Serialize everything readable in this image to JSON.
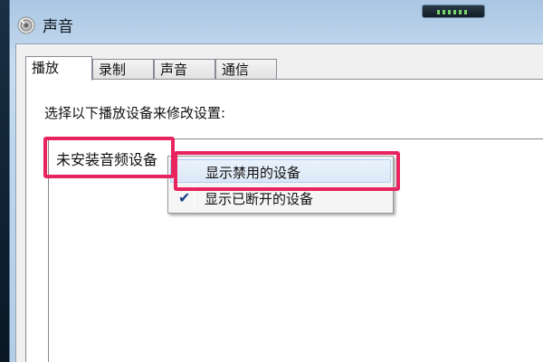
{
  "window": {
    "title": "声音"
  },
  "tabs": [
    {
      "label": "播放",
      "active": true
    },
    {
      "label": "录制",
      "active": false
    },
    {
      "label": "声音",
      "active": false
    },
    {
      "label": "通信",
      "active": false
    }
  ],
  "playback": {
    "instruction": "选择以下播放设备来修改设置:",
    "empty_text": "未安装音频设备"
  },
  "context_menu": {
    "items": [
      {
        "label": "显示禁用的设备",
        "checked": false,
        "hovered": true
      },
      {
        "label": "显示已断开的设备",
        "checked": true,
        "hovered": false
      }
    ]
  },
  "colors": {
    "highlight": "#e8245e",
    "check": "#1a3e8a"
  }
}
